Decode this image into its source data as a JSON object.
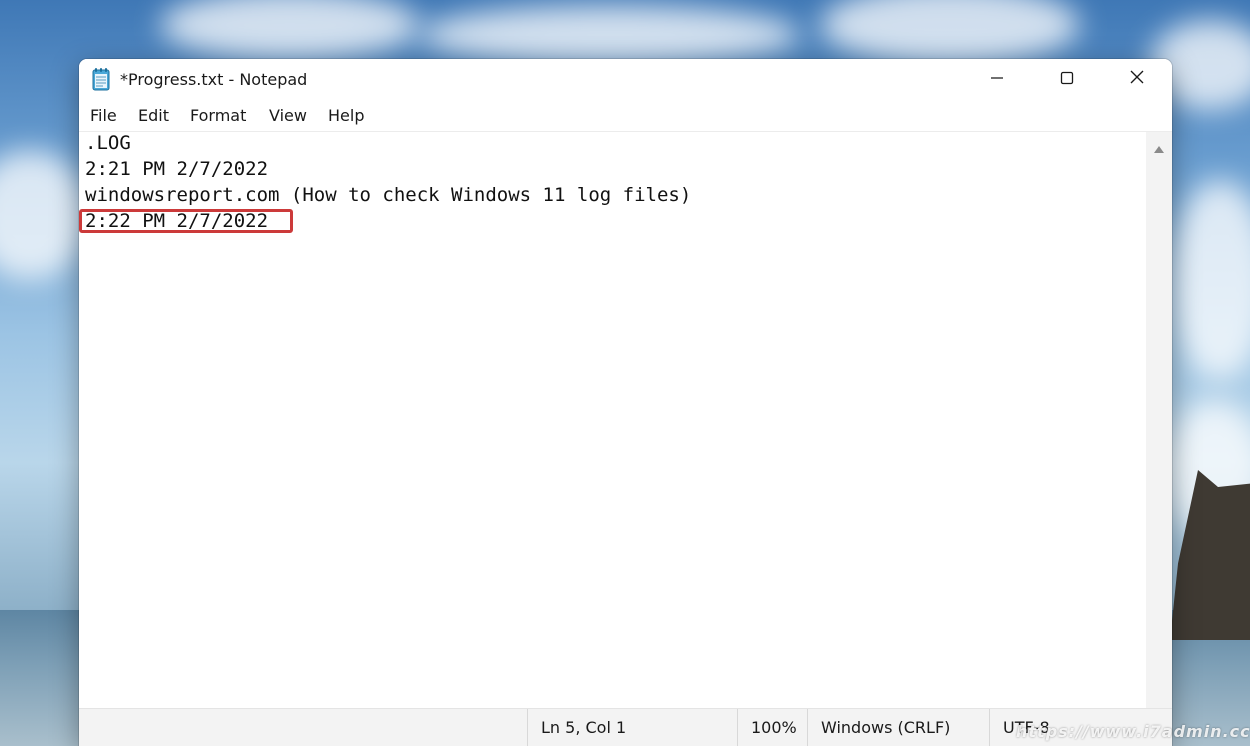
{
  "window": {
    "title": "*Progress.txt - Notepad"
  },
  "icons": {
    "app": "notepad-icon",
    "minimize": "minimize-icon",
    "maximize": "maximize-icon",
    "close": "close-icon",
    "scroll_up": "scroll-up-arrow-icon"
  },
  "menu": {
    "file": "File",
    "edit": "Edit",
    "format": "Format",
    "view": "View",
    "help": "Help"
  },
  "editor": {
    "lines": [
      ".LOG",
      "2:21 PM 2/7/2022",
      "windowsreport.com (How to check Windows 11 log files)",
      "2:22 PM 2/7/2022"
    ]
  },
  "status": {
    "position": "Ln 5, Col 1",
    "zoom": "100%",
    "line_ending": "Windows (CRLF)",
    "encoding": "UTF-8"
  },
  "watermark": {
    "text": "https://www.i7admin.cc"
  },
  "colors": {
    "highlight": "#cc3a3a",
    "window_bg": "#ffffff",
    "statusbar_bg": "#f3f3f3"
  }
}
